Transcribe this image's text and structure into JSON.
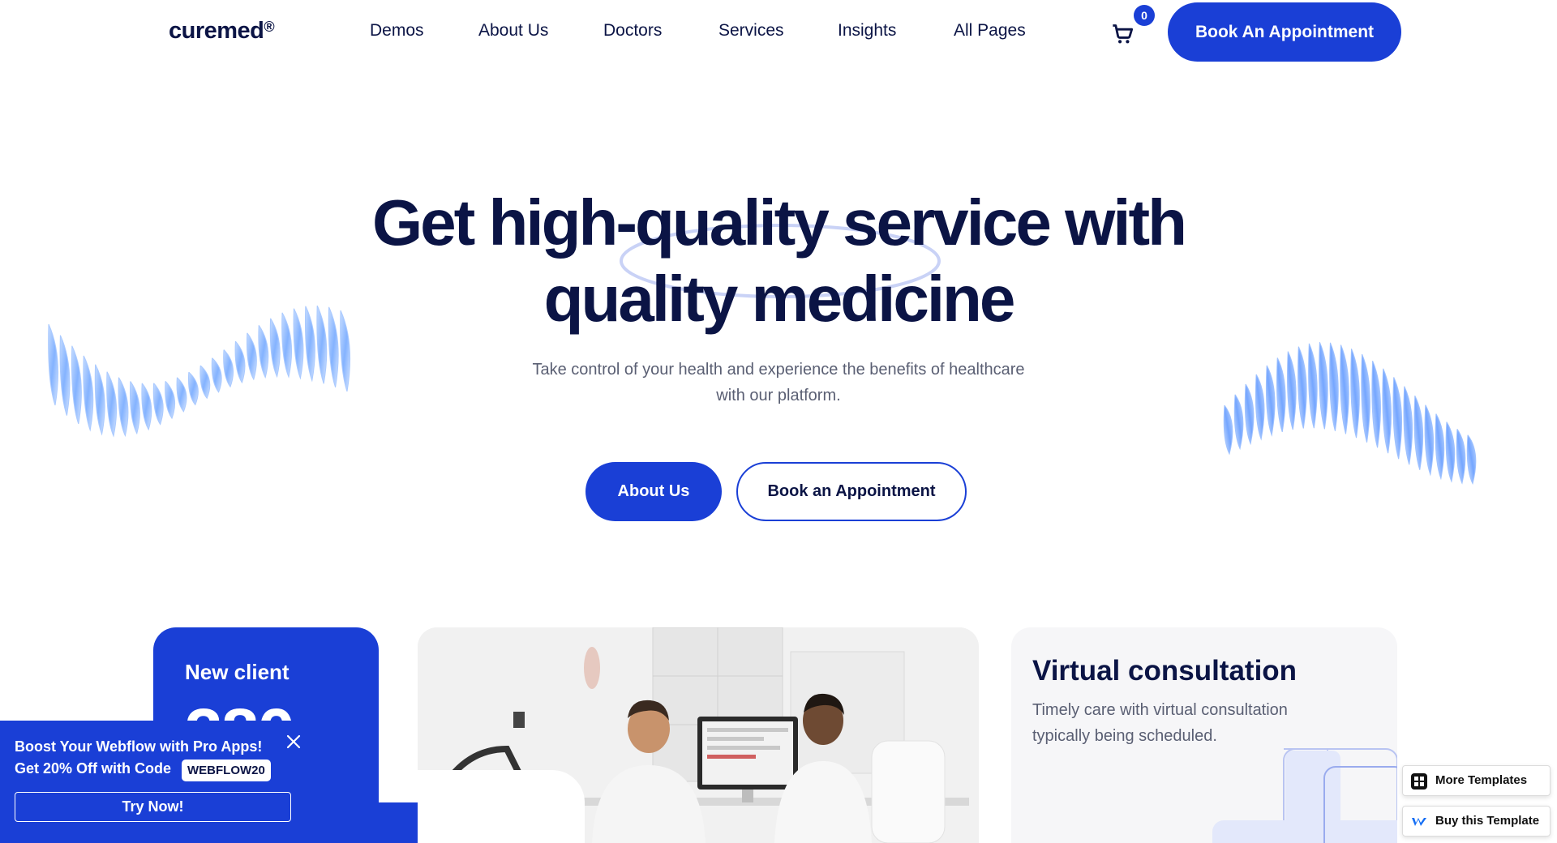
{
  "brand": {
    "logo": "curemed",
    "logo_mark": "®",
    "accent": "#1a3fd6",
    "text_dark": "#0b1445"
  },
  "nav": {
    "items": [
      {
        "label": "Demos"
      },
      {
        "label": "About Us"
      },
      {
        "label": "Doctors"
      },
      {
        "label": "Services"
      },
      {
        "label": "Insights"
      },
      {
        "label": "All Pages"
      }
    ],
    "cart_count": "0",
    "cta": "Book An Appointment"
  },
  "hero": {
    "title_line1": "Get high-quality service with",
    "title_line2": "quality medicine",
    "subtitle_line1": "Take control of your health and experience the benefits of healthcare",
    "subtitle_line2": "with our platform.",
    "primary_button": "About Us",
    "secondary_button": "Book an Appointment"
  },
  "cards": {
    "client": {
      "label": "New client",
      "number": "380"
    },
    "virtual": {
      "title": "Virtual consultation",
      "subtitle": "Timely care with virtual consultation typically being scheduled."
    }
  },
  "promo": {
    "line1": "Boost Your Webflow with Pro Apps!",
    "line2": "Get 20% Off with Code",
    "code": "WEBFLOW20",
    "button": "Try Now!"
  },
  "floating": {
    "more_templates": "More Templates",
    "buy_template": "Buy this Template"
  }
}
